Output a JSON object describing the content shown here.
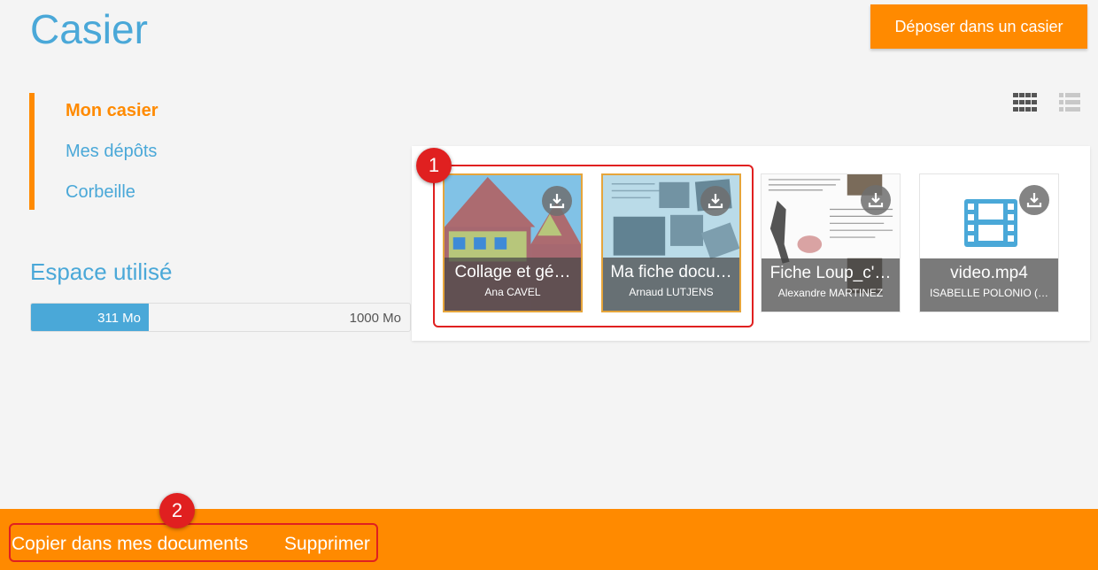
{
  "page": {
    "title": "Casier"
  },
  "header": {
    "deposit_label": "Déposer dans un casier"
  },
  "nav": {
    "items": [
      {
        "label": "Mon casier",
        "active": true
      },
      {
        "label": "Mes dépôts",
        "active": false
      },
      {
        "label": "Corbeille",
        "active": false
      }
    ]
  },
  "storage": {
    "title": "Espace utilisé",
    "used_label": "311 Mo",
    "total_label": "1000 Mo",
    "used_fraction": 0.311
  },
  "view_toggle": {
    "grid_icon": "grid-view-icon",
    "list_icon": "list-view-icon"
  },
  "files": [
    {
      "name": "Collage et gé…",
      "author": "Ana CAVEL",
      "selected": true,
      "icon": "download-icon"
    },
    {
      "name": "Ma fiche docu…",
      "author": "Arnaud LUTJENS",
      "selected": true,
      "icon": "download-icon"
    },
    {
      "name": "Fiche Loup_c'…",
      "author": "Alexandre MARTINEZ",
      "selected": false,
      "icon": "download-icon"
    },
    {
      "name": "video.mp4",
      "author": "ISABELLE POLONIO (…",
      "selected": false,
      "icon": "video-file-icon"
    }
  ],
  "annotations": {
    "marker_1": "1",
    "marker_2": "2"
  },
  "bottom_bar": {
    "copy_label": "Copier dans mes documents",
    "delete_label": "Supprimer"
  },
  "colors": {
    "accent": "#ff8a00",
    "primary": "#4aa8d8",
    "annotation": "#e02020"
  }
}
